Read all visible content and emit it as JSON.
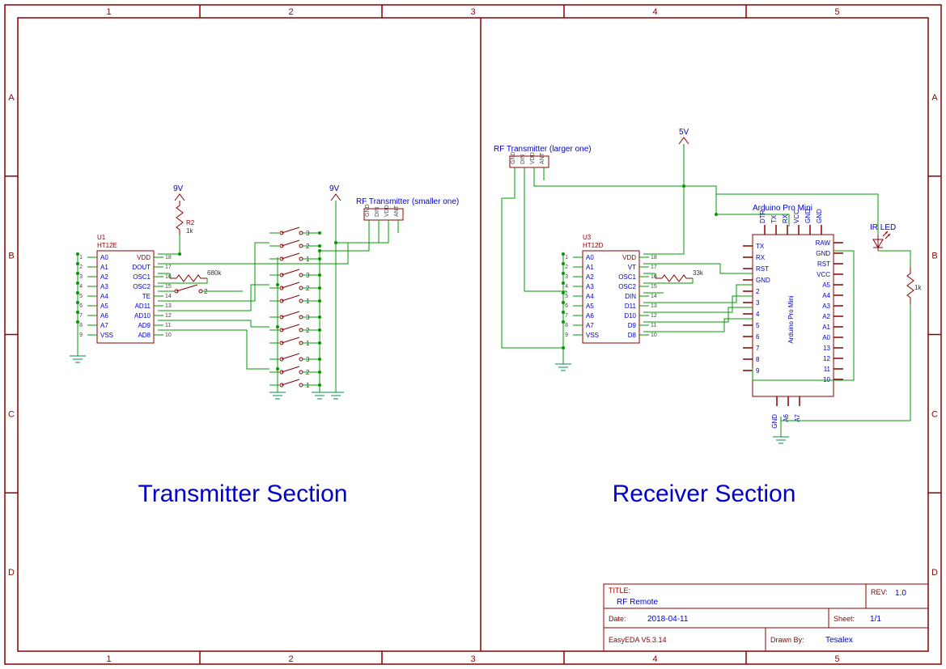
{
  "frame": {
    "cols": [
      "1",
      "2",
      "3",
      "4",
      "5"
    ],
    "rows": [
      "A",
      "B",
      "C",
      "D"
    ]
  },
  "sections": {
    "tx": "Transmitter Section",
    "rx": "Receiver Section"
  },
  "labels": {
    "tx_rf": "RF Transmitter (smaller one)",
    "rx_rf": "RF Transmitter (larger one)",
    "arduino": "Arduino Pro Mini",
    "ir_led": "IR LED",
    "v9": "9V",
    "v9b": "9V",
    "v5": "5V"
  },
  "components": {
    "u1": {
      "ref": "U1",
      "part": "HT12E",
      "left": [
        "A0",
        "A1",
        "A2",
        "A3",
        "A4",
        "A5",
        "A6",
        "A7",
        "VSS"
      ],
      "right": [
        "VDD",
        "DOUT",
        "OSC1",
        "OSC2",
        "TE",
        "AD11",
        "AD10",
        "AD9",
        "AD8"
      ],
      "ln": [
        "1",
        "2",
        "3",
        "4",
        "5",
        "6",
        "7",
        "8",
        "9"
      ],
      "rn": [
        "18",
        "17",
        "16",
        "15",
        "14",
        "13",
        "12",
        "11",
        "10"
      ]
    },
    "u3": {
      "ref": "U3",
      "part": "HT12D",
      "left": [
        "A0",
        "A1",
        "A2",
        "A3",
        "A4",
        "A5",
        "A6",
        "A7",
        "VSS"
      ],
      "right": [
        "VDD",
        "VT",
        "OSC1",
        "OSC2",
        "DIN",
        "D11",
        "D10",
        "D9",
        "D8"
      ],
      "ln": [
        "1",
        "2",
        "3",
        "4",
        "5",
        "6",
        "7",
        "8",
        "9"
      ],
      "rn": [
        "18",
        "17",
        "16",
        "15",
        "14",
        "13",
        "12",
        "11",
        "10"
      ]
    },
    "arduino_pins": {
      "top": [
        "DTR",
        "TX",
        "RX",
        "VCC",
        "GND",
        "GND"
      ],
      "left": [
        "TX",
        "RX",
        "RST",
        "GND",
        "2",
        "3",
        "4",
        "5",
        "6",
        "7",
        "8",
        "9"
      ],
      "right": [
        "RAW",
        "GND",
        "RST",
        "VCC",
        "A5",
        "A4",
        "A3",
        "A2",
        "A1",
        "A0",
        "13",
        "12",
        "11",
        "10"
      ],
      "bottom": [
        "GND",
        "A6",
        "A7"
      ],
      "body": "Arduino Pro Mini"
    },
    "rf_tx_pins": [
      "GND",
      "DIN",
      "VDD",
      "ANT"
    ],
    "rf_rx_pins": [
      "GND",
      "DIN",
      "VDD",
      "ANT"
    ],
    "r2": {
      "ref": "R2",
      "val": "1k"
    },
    "r_680k": "680k",
    "r_33k": "33k",
    "r_1k": "1k",
    "sw_labels": [
      "1",
      "2",
      "3"
    ]
  },
  "titleblock": {
    "title_label": "TITLE:",
    "title": "RF Remote",
    "rev_label": "REV:",
    "rev": "1.0",
    "date_label": "Date:",
    "date": "2018-04-11",
    "sheet_label": "Sheet:",
    "sheet": "1/1",
    "tool": "EasyEDA V5.3.14",
    "drawn_label": "Drawn By:",
    "drawn": "Tesalex"
  }
}
